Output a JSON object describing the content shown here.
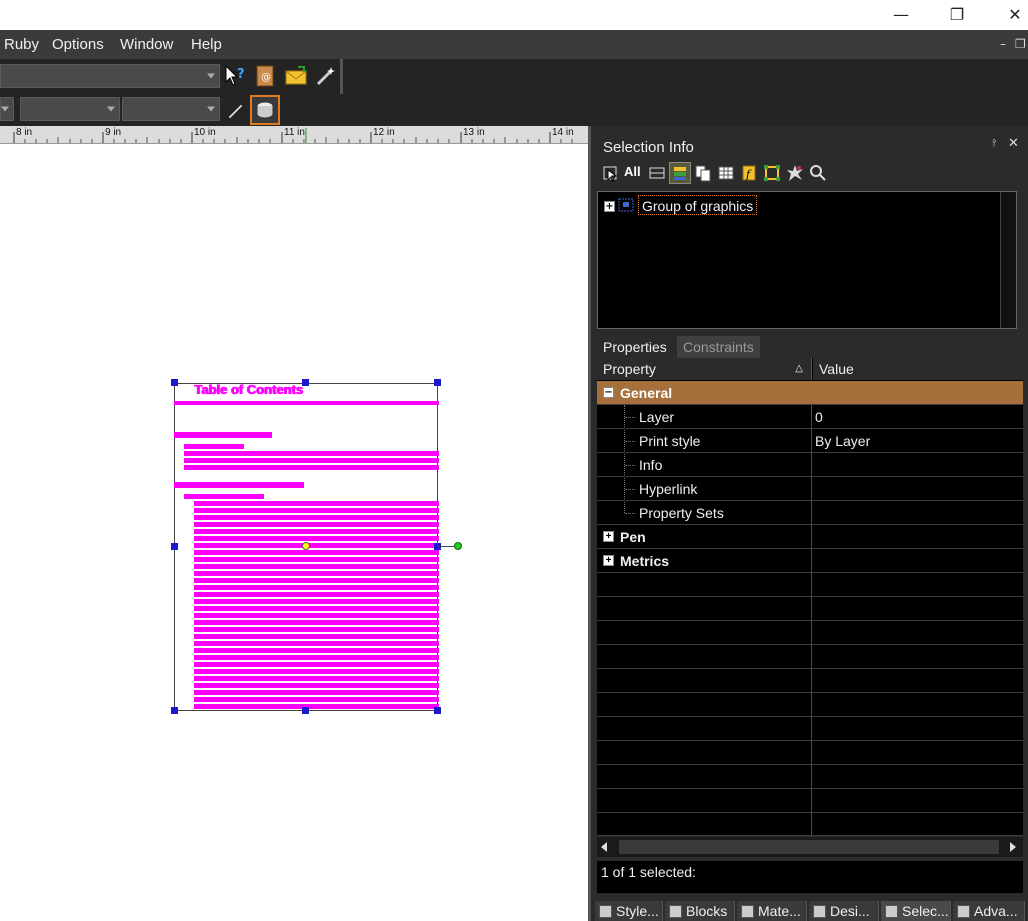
{
  "window": {
    "minimize_glyph": "—",
    "restore_glyph": "❐",
    "close_glyph": "✕"
  },
  "menubar": {
    "items": [
      "Ruby",
      "Options",
      "Window",
      "Help"
    ],
    "mdi_minimize": "–",
    "mdi_restore": "❐"
  },
  "ruler": {
    "labels": [
      "8 in",
      "9 in",
      "10 in",
      "11 in",
      "12 in",
      "13 in",
      "14 in"
    ]
  },
  "canvas": {
    "drawing_title": "Table of Contents"
  },
  "panel": {
    "title": "Selection Info",
    "pin_glyph": "📌",
    "close_glyph": "✕",
    "toolbar_all_label": "All",
    "tree_item": "Group of graphics",
    "tabs": [
      "Properties",
      "Constraints"
    ],
    "grid_headers": {
      "property": "Property",
      "value": "Value",
      "sort_glyph": "△"
    },
    "rows": [
      {
        "property": "General",
        "value": "",
        "category": true,
        "expanded": true
      },
      {
        "property": "Layer",
        "value": "0"
      },
      {
        "property": "Print style",
        "value": "By Layer"
      },
      {
        "property": "Info",
        "value": ""
      },
      {
        "property": "Hyperlink",
        "value": ""
      },
      {
        "property": "Property Sets",
        "value": ""
      },
      {
        "property": "Pen",
        "value": "",
        "category": true,
        "expanded": false
      },
      {
        "property": "Metrics",
        "value": "",
        "category": true,
        "expanded": false
      }
    ],
    "status": "1 of 1 selected:",
    "bottom_tabs": [
      "Style...",
      "Blocks",
      "Mate...",
      "Desi...",
      "Selec...",
      "Adva..."
    ]
  },
  "colors": {
    "accent_category": "#a5703b",
    "magenta": "#ff00ff",
    "handle": "#1a1acc",
    "panel_bg": "#2b2b2b",
    "toolbar_bg": "#242424"
  }
}
